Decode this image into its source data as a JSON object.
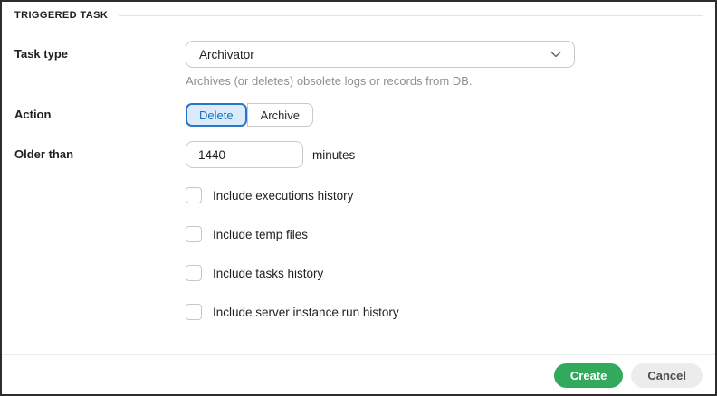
{
  "panel": {
    "title": "TRIGGERED TASK"
  },
  "form": {
    "task_type": {
      "label": "Task type",
      "value": "Archivator",
      "help": "Archives (or deletes) obsolete logs or records from DB."
    },
    "action": {
      "label": "Action",
      "options": [
        {
          "label": "Delete",
          "selected": true
        },
        {
          "label": "Archive",
          "selected": false
        }
      ]
    },
    "older_than": {
      "label": "Older than",
      "value": "1440",
      "unit": "minutes"
    },
    "checkboxes": [
      {
        "label": "Include executions history",
        "checked": false
      },
      {
        "label": "Include temp files",
        "checked": false
      },
      {
        "label": "Include tasks history",
        "checked": false
      },
      {
        "label": "Include server instance run history",
        "checked": false
      }
    ]
  },
  "footer": {
    "create_label": "Create",
    "cancel_label": "Cancel"
  },
  "colors": {
    "selected_segment_border": "#2677c8",
    "selected_segment_bg": "#dcebfa",
    "selected_segment_text": "#1670c5",
    "create_button_bg": "#31aa5d",
    "cancel_button_bg": "#ececec",
    "page_border": "#2d2d2d"
  }
}
